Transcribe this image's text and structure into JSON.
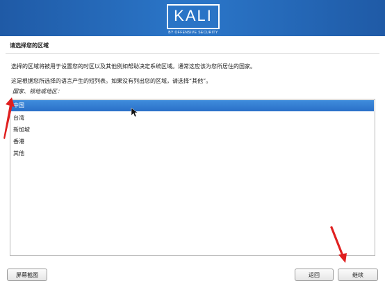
{
  "header": {
    "logo_text": "KALI",
    "logo_subtitle": "BY OFFENSIVE SECURITY"
  },
  "page": {
    "title": "请选择您的区域",
    "description_1": "选择的区域将被用于设置您的时区以及其他例如帮助决定系统区域。通常这应该为您所居住的国家。",
    "description_2": "这是根据您所选择的语言产生的短列表。如果没有列出您的区域，请选择“其他”。",
    "prompt": "国家、领地或地区："
  },
  "list": {
    "items": [
      {
        "label": "中国",
        "selected": true
      },
      {
        "label": "台湾",
        "selected": false
      },
      {
        "label": "新加坡",
        "selected": false
      },
      {
        "label": "香港",
        "selected": false
      },
      {
        "label": "其他",
        "selected": false
      }
    ]
  },
  "buttons": {
    "screenshot": "屏幕截图",
    "back": "返回",
    "continue": "继续"
  },
  "colors": {
    "banner": "#2a74c6",
    "selection": "#2a6fc8",
    "annotation_arrow": "#e02020"
  }
}
